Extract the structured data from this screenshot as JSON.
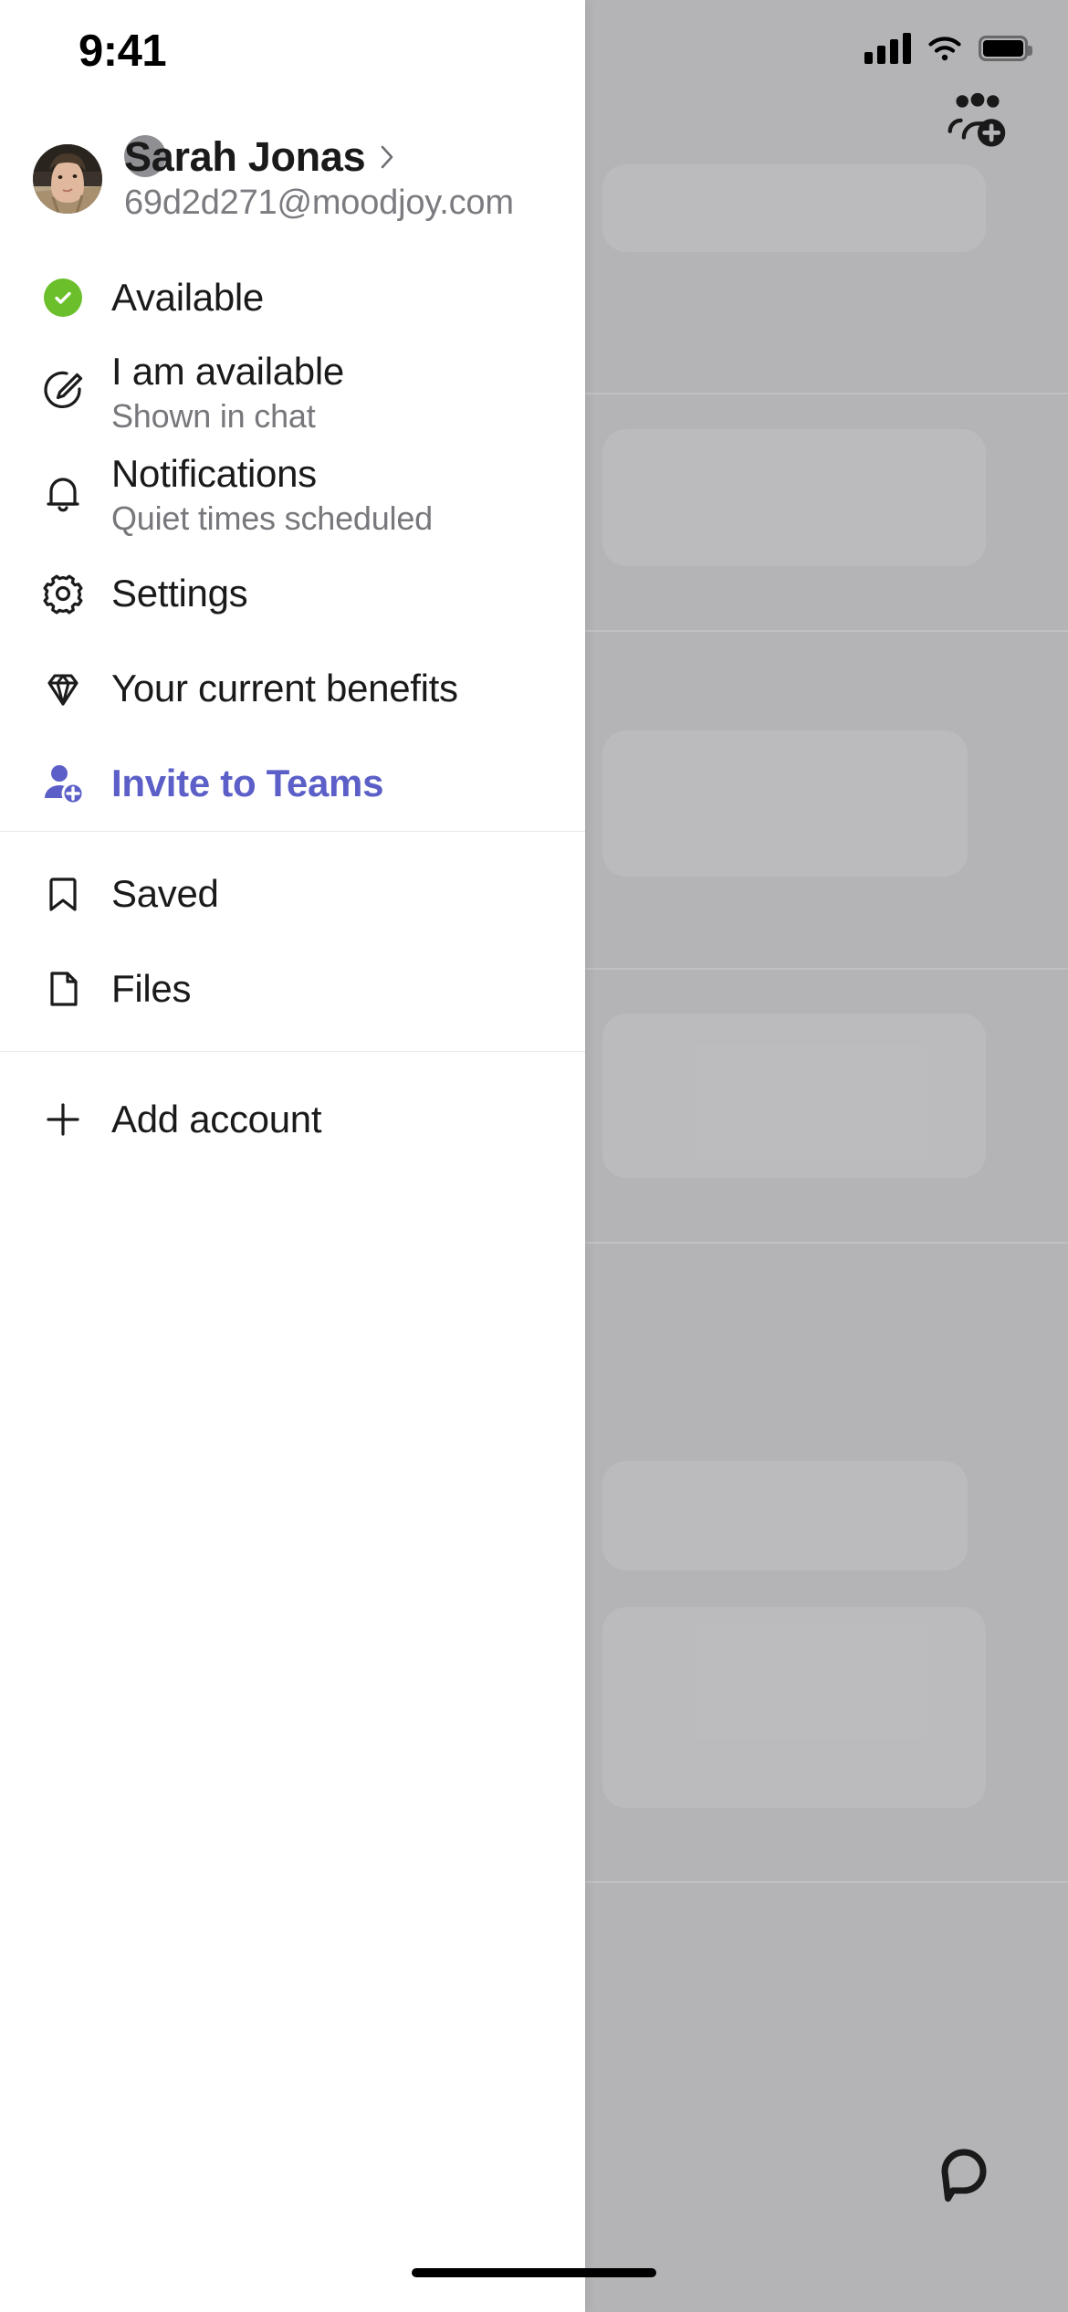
{
  "status_bar": {
    "time": "9:41",
    "cellular_icon": "cellular-bars-icon",
    "wifi_icon": "wifi-icon",
    "battery_icon": "battery-full-icon"
  },
  "background": {
    "add_people_icon": "add-people-icon",
    "chat_tab_icon": "chat-bubble-icon",
    "scrim_color": "#b4b3b6"
  },
  "profile": {
    "name": "Sarah Jonas",
    "email": "69d2d271@moodjoy.com",
    "chevron_icon": "chevron-right-icon",
    "avatar_name": "user-avatar"
  },
  "colors": {
    "accent": "#5b5fc7",
    "available_green": "#6bbf2b",
    "primary_text": "#1a1a1a",
    "secondary_text": "#77777c",
    "divider": "#e9e9ea"
  },
  "menu": {
    "section_one": [
      {
        "id": "availability",
        "icon": "check-circle-icon",
        "title": "Available",
        "subtitle": ""
      },
      {
        "id": "status-message",
        "icon": "edit-pencil-circle-icon",
        "title": "I am available",
        "subtitle": "Shown in chat"
      },
      {
        "id": "notifications",
        "icon": "bell-icon",
        "title": "Notifications",
        "subtitle": "Quiet times scheduled"
      },
      {
        "id": "settings",
        "icon": "gear-icon",
        "title": "Settings",
        "subtitle": ""
      },
      {
        "id": "benefits",
        "icon": "diamond-icon",
        "title": "Your current benefits",
        "subtitle": ""
      },
      {
        "id": "invite",
        "icon": "person-add-icon",
        "title": "Invite to Teams",
        "subtitle": ""
      }
    ],
    "section_two": [
      {
        "id": "saved",
        "icon": "bookmark-icon",
        "title": "Saved",
        "subtitle": ""
      },
      {
        "id": "files",
        "icon": "file-icon",
        "title": "Files",
        "subtitle": ""
      }
    ],
    "section_three": [
      {
        "id": "add-account",
        "icon": "plus-icon",
        "title": "Add account",
        "subtitle": ""
      }
    ]
  }
}
